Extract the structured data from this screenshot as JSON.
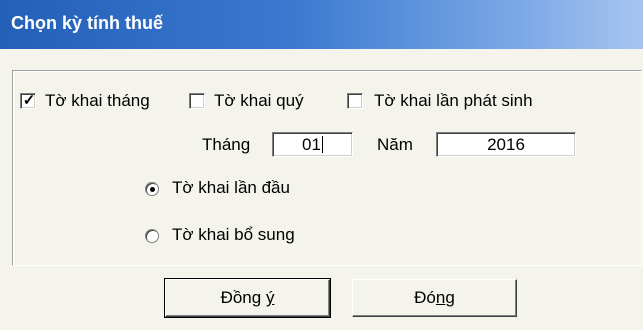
{
  "dialog": {
    "title": "Chọn kỳ tính thuế"
  },
  "declaration_types": {
    "monthly": {
      "label": "Tờ khai tháng",
      "checked": true,
      "check_mark": "✓"
    },
    "quarterly": {
      "label": "Tờ khai quý",
      "checked": false
    },
    "occurrence": {
      "label": "Tờ khai lần phát sinh",
      "checked": false
    }
  },
  "period": {
    "month_label": "Tháng",
    "month_value": "01",
    "year_label": "Năm",
    "year_value": "2016"
  },
  "submission": {
    "initial": {
      "label": "Tờ khai lần đầu",
      "selected": true
    },
    "supplementary": {
      "label": "Tờ khai bổ sung",
      "selected": false
    }
  },
  "buttons": {
    "ok": {
      "pre": "Đồng ",
      "mnemonic": "ý",
      "post": ""
    },
    "close": {
      "pre": "Đó",
      "mnemonic": "n",
      "post": "g"
    }
  }
}
